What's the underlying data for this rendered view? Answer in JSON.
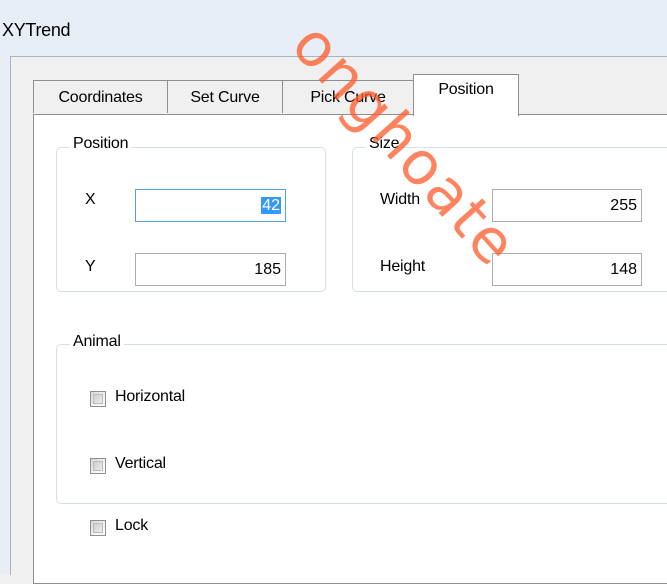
{
  "window": {
    "title": "XYTrend"
  },
  "tabs": [
    {
      "label": "Coordinates",
      "active": false
    },
    {
      "label": "Set Curve",
      "active": false
    },
    {
      "label": "Pick Curve",
      "active": false
    },
    {
      "label": "Position",
      "active": true
    }
  ],
  "position_group": {
    "legend": "Position",
    "x_label": "X",
    "x_value": "42",
    "y_label": "Y",
    "y_value": "185"
  },
  "size_group": {
    "legend": "Size",
    "width_label": "Width",
    "width_value": "255",
    "height_label": "Height",
    "height_value": "148"
  },
  "animal_group": {
    "legend": "Animal",
    "horizontal_label": "Horizontal",
    "horizontal_checked": false,
    "vertical_label": "Vertical",
    "vertical_checked": false
  },
  "lock": {
    "label": "Lock",
    "checked": false
  },
  "watermark": {
    "text": "onghoate",
    "color": "#ff5a28"
  }
}
